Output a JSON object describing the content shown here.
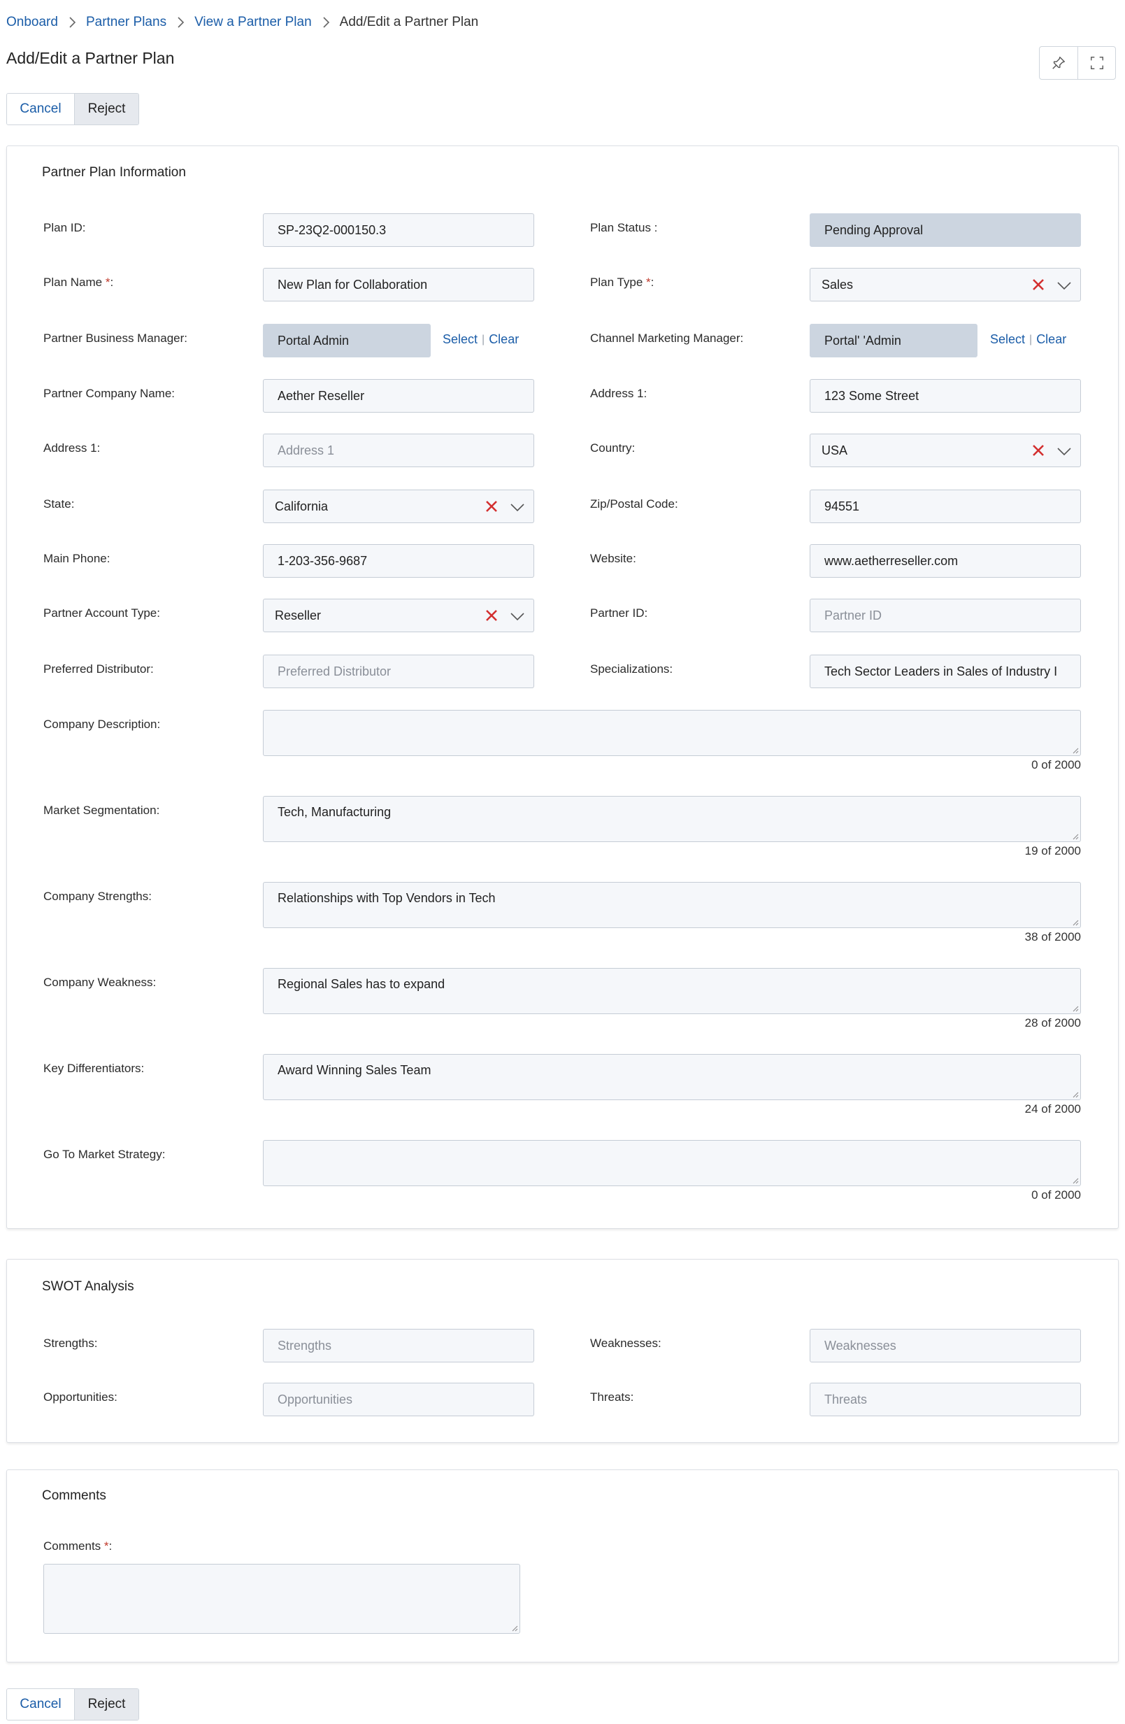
{
  "breadcrumb": {
    "items": [
      "Onboard",
      "Partner Plans",
      "View a Partner Plan"
    ],
    "current": "Add/Edit a Partner Plan"
  },
  "page": {
    "title": "Add/Edit a Partner Plan"
  },
  "actions": {
    "cancel": "Cancel",
    "reject": "Reject"
  },
  "icons": {
    "pin": "pin-icon",
    "expand": "expand-icon",
    "clear": "x-icon",
    "dropdown": "chevron-down-icon"
  },
  "colors": {
    "link": "#1b5da8",
    "clear_x": "#d32f2f",
    "readonly_bg": "#ccd5e0"
  },
  "info": {
    "title": "Partner Plan Information",
    "plan_id": {
      "label": "Plan ID:",
      "value": "SP-23Q2-000150.3"
    },
    "plan_status": {
      "label": "Plan Status :",
      "value": "Pending Approval"
    },
    "plan_name": {
      "label": "Plan Name",
      "required": "*",
      "suffix": ":",
      "value": "New Plan for Collaboration"
    },
    "plan_type": {
      "label": "Plan Type",
      "required": "*",
      "suffix": ":",
      "value": "Sales"
    },
    "pbm": {
      "label": "Partner Business Manager:",
      "value": "Portal Admin",
      "select": "Select",
      "separator": "|",
      "clear": "Clear"
    },
    "cmm": {
      "label": "Channel Marketing Manager:",
      "value": "Portal' 'Admin",
      "select": "Select",
      "separator": "|",
      "clear": "Clear"
    },
    "company_name": {
      "label": "Partner Company Name:",
      "value": "Aether Reseller"
    },
    "address1_right": {
      "label": "Address 1:",
      "value": "123 Some Street"
    },
    "address1_left": {
      "label": "Address 1:",
      "placeholder": "Address 1"
    },
    "country": {
      "label": "Country:",
      "value": "USA"
    },
    "state": {
      "label": "State:",
      "value": "California"
    },
    "zip": {
      "label": "Zip/Postal Code:",
      "value": "94551"
    },
    "phone": {
      "label": "Main Phone:",
      "value": "1-203-356-9687"
    },
    "website": {
      "label": "Website:",
      "value": "www.aetherreseller.com"
    },
    "account_type": {
      "label": "Partner Account Type:",
      "value": "Reseller"
    },
    "partner_id": {
      "label": "Partner ID:",
      "placeholder": "Partner ID"
    },
    "preferred_distributor": {
      "label": "Preferred Distributor:",
      "placeholder": "Preferred Distributor"
    },
    "specializations": {
      "label": "Specializations:",
      "value": "Tech Sector Leaders in Sales of Industry I"
    },
    "company_description": {
      "label": "Company Description:",
      "value": "",
      "counter": "0 of 2000"
    },
    "market_segmentation": {
      "label": "Market Segmentation:",
      "value": "Tech, Manufacturing",
      "counter": "19 of 2000"
    },
    "company_strengths": {
      "label": "Company Strengths:",
      "value": "Relationships with Top Vendors in Tech",
      "counter": "38 of 2000"
    },
    "company_weakness": {
      "label": "Company Weakness:",
      "value": "Regional Sales has to expand",
      "counter": "28 of 2000"
    },
    "key_differentiators": {
      "label": "Key Differentiators:",
      "value": "Award Winning Sales Team",
      "counter": "24 of 2000"
    },
    "gtm_strategy": {
      "label": "Go To Market Strategy:",
      "value": "",
      "counter": "0 of 2000"
    }
  },
  "swot": {
    "title": "SWOT Analysis",
    "strengths": {
      "label": "Strengths:",
      "placeholder": "Strengths"
    },
    "weaknesses": {
      "label": "Weaknesses:",
      "placeholder": "Weaknesses"
    },
    "opportunities": {
      "label": "Opportunities:",
      "placeholder": "Opportunities"
    },
    "threats": {
      "label": "Threats:",
      "placeholder": "Threats"
    }
  },
  "comments": {
    "title": "Comments",
    "label": "Comments",
    "required": "*",
    "suffix": ":",
    "value": ""
  }
}
